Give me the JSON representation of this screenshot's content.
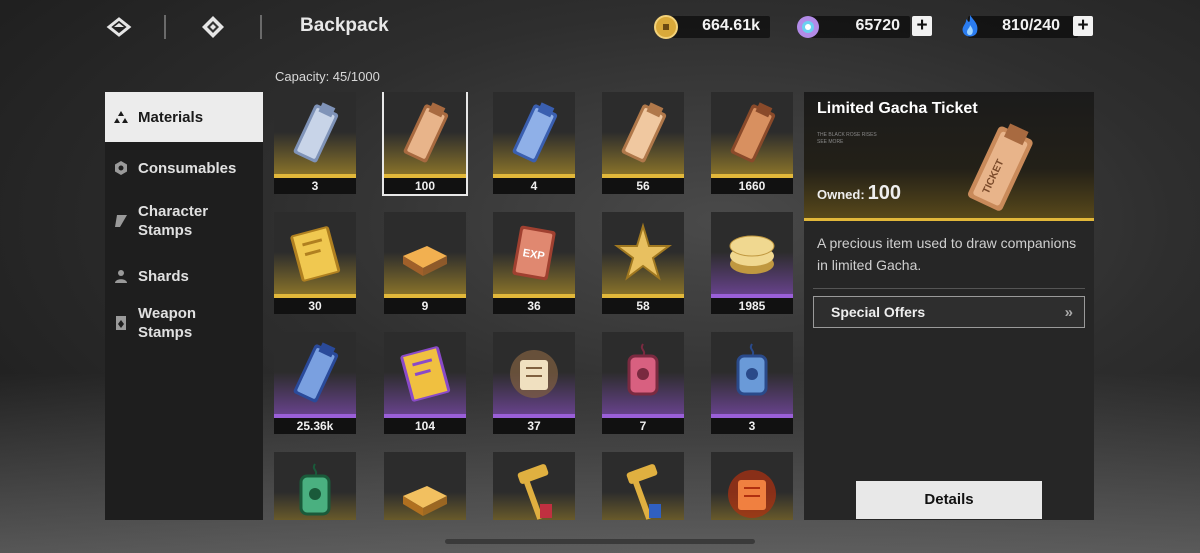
{
  "header": {
    "title": "Backpack",
    "currencies": [
      {
        "icon": "coin-icon",
        "value": "664.61k",
        "has_plus": false
      },
      {
        "icon": "gem-icon",
        "value": "65720",
        "has_plus": true
      },
      {
        "icon": "blue-flame-icon",
        "value": "810/240",
        "has_plus": true
      }
    ],
    "plus_label": "+"
  },
  "capacity": "Capacity: 45/1000",
  "sidebar": {
    "items": [
      {
        "label": "Materials",
        "icon": "triangle-cluster-icon",
        "active": true
      },
      {
        "label": "Consumables",
        "icon": "hexagon-icon",
        "active": false
      },
      {
        "label": "Character Stamps",
        "icon": "stamp-icon",
        "active": false
      },
      {
        "label": "Shards",
        "icon": "person-icon",
        "active": false
      },
      {
        "label": "Weapon Stamps",
        "icon": "card-icon",
        "active": false
      }
    ]
  },
  "grid": {
    "items": [
      {
        "icon": "silver-ticket-icon",
        "count": "3",
        "rarity": "gold"
      },
      {
        "icon": "limited-gacha-ticket-icon",
        "count": "100",
        "rarity": "gold",
        "selected": true
      },
      {
        "icon": "blue-ticket-icon",
        "count": "4",
        "rarity": "gold"
      },
      {
        "icon": "bronze-ticket-icon",
        "count": "56",
        "rarity": "gold"
      },
      {
        "icon": "copper-ticket-icon",
        "count": "1660",
        "rarity": "gold"
      },
      {
        "icon": "gold-book-icon",
        "count": "30",
        "rarity": "gold"
      },
      {
        "icon": "gold-bars-icon",
        "count": "9",
        "rarity": "gold"
      },
      {
        "icon": "exp-card-icon",
        "count": "36",
        "rarity": "gold"
      },
      {
        "icon": "gold-star-icon",
        "count": "58",
        "rarity": "gold"
      },
      {
        "icon": "coin-stack-icon",
        "count": "1985",
        "rarity": "purple"
      },
      {
        "icon": "blue-star-ticket-icon",
        "count": "25.36k",
        "rarity": "purple"
      },
      {
        "icon": "purple-book-icon",
        "count": "104",
        "rarity": "purple"
      },
      {
        "icon": "scroll-bundle-icon",
        "count": "37",
        "rarity": "purple"
      },
      {
        "icon": "red-charm-icon",
        "count": "7",
        "rarity": "purple"
      },
      {
        "icon": "blue-charm-icon",
        "count": "3",
        "rarity": "purple"
      },
      {
        "icon": "green-charm-icon",
        "count": "",
        "rarity": "gold"
      },
      {
        "icon": "gold-bar-icon",
        "count": "",
        "rarity": "gold"
      },
      {
        "icon": "red-hammer-icon",
        "count": "",
        "rarity": "gold"
      },
      {
        "icon": "blue-hammer-icon",
        "count": "",
        "rarity": "gold"
      },
      {
        "icon": "fire-scroll-icon",
        "count": "",
        "rarity": "gold"
      }
    ]
  },
  "detail": {
    "title": "Limited Gacha Ticket",
    "fine_print": "THE BLACK ROSE RISES",
    "fine_print2": "SEE MORE",
    "owned_label": "Owned:",
    "owned_value": "100",
    "description": "A precious item used to draw companions in limited Gacha.",
    "offers_label": "Special Offers",
    "offers_chevron": "»"
  },
  "details_button": "Details",
  "colors": {
    "gold": "#e2b83a",
    "purple": "#9a5fd8",
    "panel": "#262626"
  }
}
